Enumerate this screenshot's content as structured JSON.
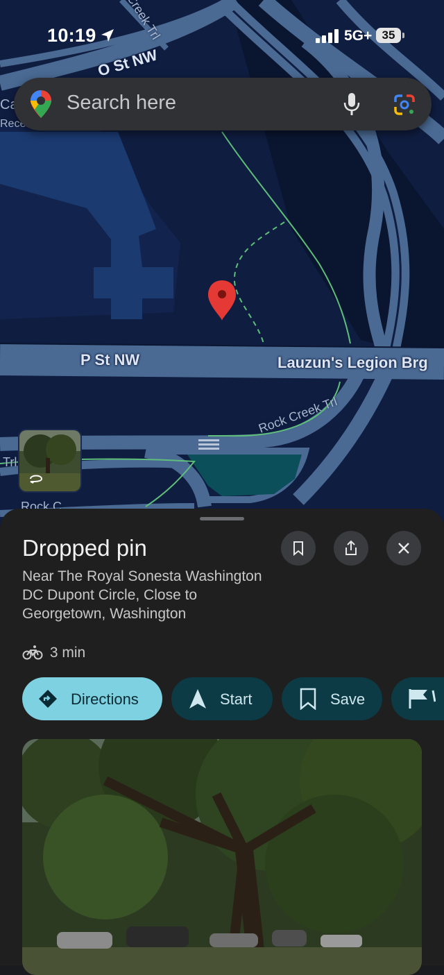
{
  "status_bar": {
    "time": "10:19",
    "network": "5G+",
    "battery": "35"
  },
  "search": {
    "placeholder": "Search here"
  },
  "map": {
    "labels": {
      "o_st": "O St NW",
      "p_st": "P St NW",
      "bridge": "Lauzun's Legion Brg",
      "rock_creek_trail": "Rock Creek Trl",
      "creek_trl_top": "Creek Trl",
      "trl_left": "Trl",
      "ca_partial": "Ca",
      "recent_partial": "Recen",
      "rock_c_partial": "Rock C"
    }
  },
  "place": {
    "title": "Dropped pin",
    "address": "Near The Royal Sonesta Washington DC Dupont Circle, Close to Georgetown, Washington",
    "travel_time": "3 min"
  },
  "actions": {
    "directions": "Directions",
    "start": "Start",
    "save": "Save"
  },
  "colors": {
    "map_bg": "#0f1d40",
    "road": "#4a6a93",
    "sheet_bg": "#1f1f1f",
    "primary_chip": "#7dd1e0",
    "chip_bg": "#0c3b45",
    "pin": "#e53935"
  }
}
